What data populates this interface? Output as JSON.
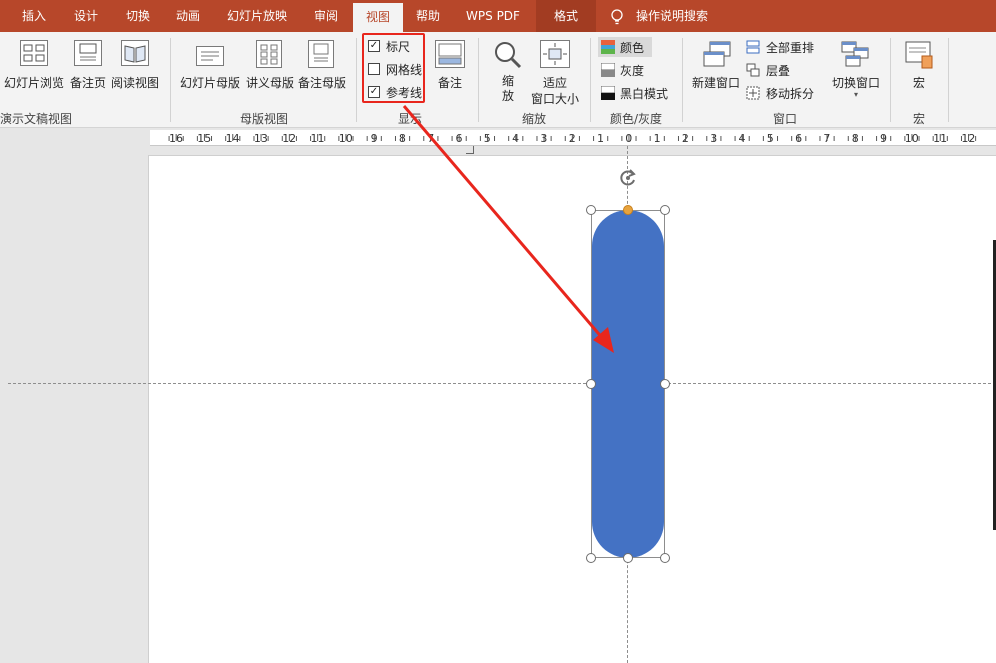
{
  "tabs": [
    {
      "label": "插入"
    },
    {
      "label": "设计"
    },
    {
      "label": "切换"
    },
    {
      "label": "动画"
    },
    {
      "label": "幻灯片放映"
    },
    {
      "label": "审阅"
    },
    {
      "label": "视图"
    },
    {
      "label": "帮助"
    },
    {
      "label": "WPS PDF"
    },
    {
      "label": "格式"
    }
  ],
  "tell_me": "操作说明搜索",
  "ribbon": {
    "presentation_views": {
      "group_label": "演示文稿视图",
      "buttons": [
        "幻灯片浏览",
        "备注页",
        "阅读视图"
      ]
    },
    "master_views": {
      "group_label": "母版视图",
      "buttons": [
        "幻灯片母版",
        "讲义母版",
        "备注母版"
      ]
    },
    "show": {
      "group_label": "显示",
      "checkboxes": [
        {
          "label": "标尺",
          "checked": true
        },
        {
          "label": "网格线",
          "checked": false
        },
        {
          "label": "参考线",
          "checked": true
        }
      ],
      "notes_button": "备注"
    },
    "zoom": {
      "group_label": "缩放",
      "zoom_button": "缩放",
      "fit_button_line1": "适应",
      "fit_button_line2": "窗口大小"
    },
    "color_grayscale": {
      "group_label": "颜色/灰度",
      "options": [
        "颜色",
        "灰度",
        "黑白模式"
      ]
    },
    "window": {
      "group_label": "窗口",
      "new_window": "新建窗口",
      "arrange_all": "全部重排",
      "cascade": "层叠",
      "move_split": "移动拆分",
      "switch_windows": "切换窗口"
    },
    "macros": {
      "group_label": "宏",
      "button": "宏"
    }
  },
  "ruler": {
    "labels": [
      "16",
      "15",
      "14",
      "13",
      "12",
      "11",
      "10",
      "9",
      "8",
      "7",
      "6",
      "5",
      "4",
      "3",
      "2",
      "1",
      "0",
      "1",
      "2",
      "3",
      "4",
      "5",
      "6",
      "7",
      "8",
      "9",
      "10",
      "11",
      "12"
    ]
  },
  "colors": {
    "tab_bar": "#b7472a",
    "shape_fill": "#4472c4",
    "annotation": "#e8261d"
  }
}
